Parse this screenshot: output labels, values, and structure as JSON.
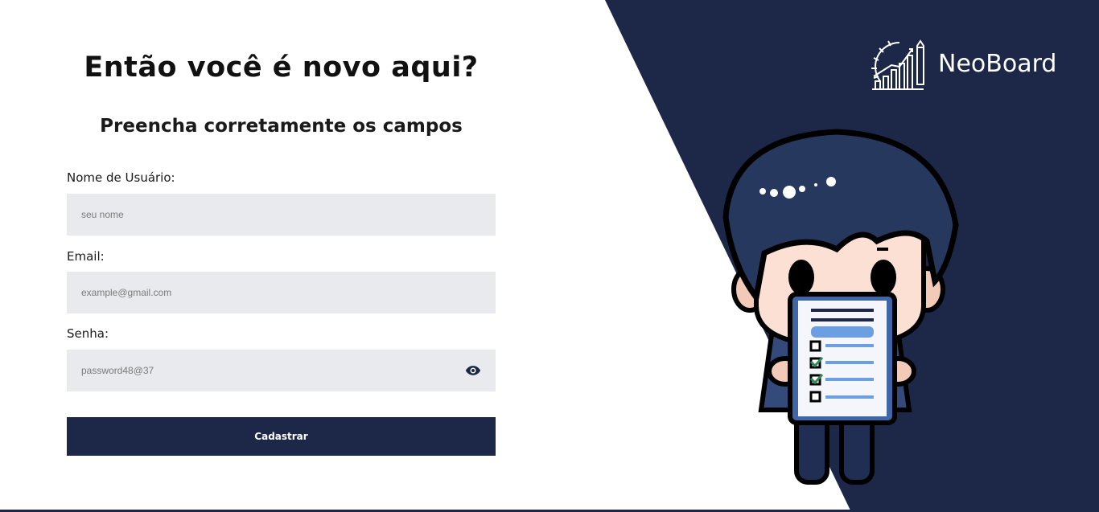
{
  "form": {
    "title": "Então você é novo aqui?",
    "subtitle": "Preencha corretamente os campos",
    "username": {
      "label": "Nome de Usuário:",
      "placeholder": "seu nome"
    },
    "email": {
      "label": "Email:",
      "placeholder": "example@gmail.com"
    },
    "password": {
      "label": "Senha:",
      "placeholder": "password48@37"
    },
    "submit_label": "Cadastrar"
  },
  "brand": {
    "name": "NeoBoard",
    "logo_icon": "growth-chart-icon"
  },
  "illustration": {
    "icon": "person-holding-checklist"
  },
  "colors": {
    "primary": "#1d2848",
    "field_bg": "#e9eaee",
    "background": "#ffffff"
  }
}
